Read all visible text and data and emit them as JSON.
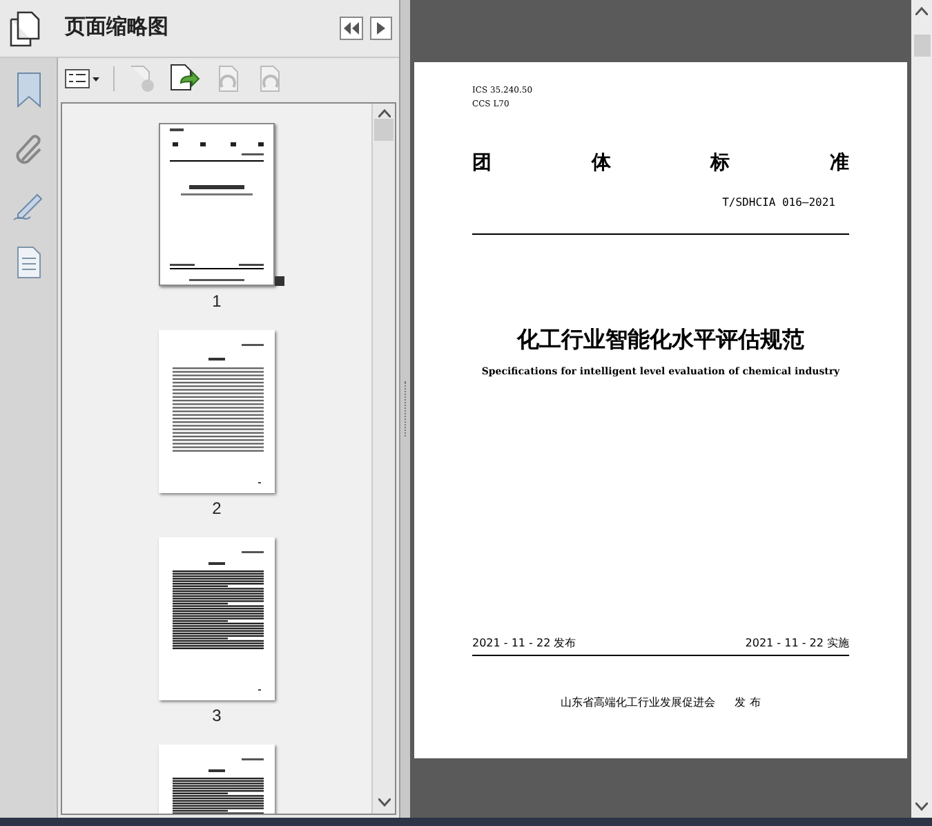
{
  "panel": {
    "title": "页面缩略图"
  },
  "thumbnails": [
    {
      "label": "1",
      "selected": true,
      "kind": "cover"
    },
    {
      "label": "2",
      "selected": false,
      "kind": "contents"
    },
    {
      "label": "3",
      "selected": false,
      "kind": "text"
    },
    {
      "selected": false,
      "kind": "text"
    }
  ],
  "page": {
    "ics": "ICS  35.240.50",
    "ccs": "CCS L70",
    "heading": [
      "团",
      "体",
      "标",
      "准"
    ],
    "code": "T/SDHCIA 016—2021",
    "title": "化工行业智能化水平评估规范",
    "subtitle": "Specifications for intelligent level evaluation of chemical industry",
    "publish_date": "2021 - 11 - 22 发布",
    "effective_date": "2021 - 11 - 22 实施",
    "issuer": "山东省高端化工行业发展促进会",
    "issuer_action": "发 布"
  }
}
